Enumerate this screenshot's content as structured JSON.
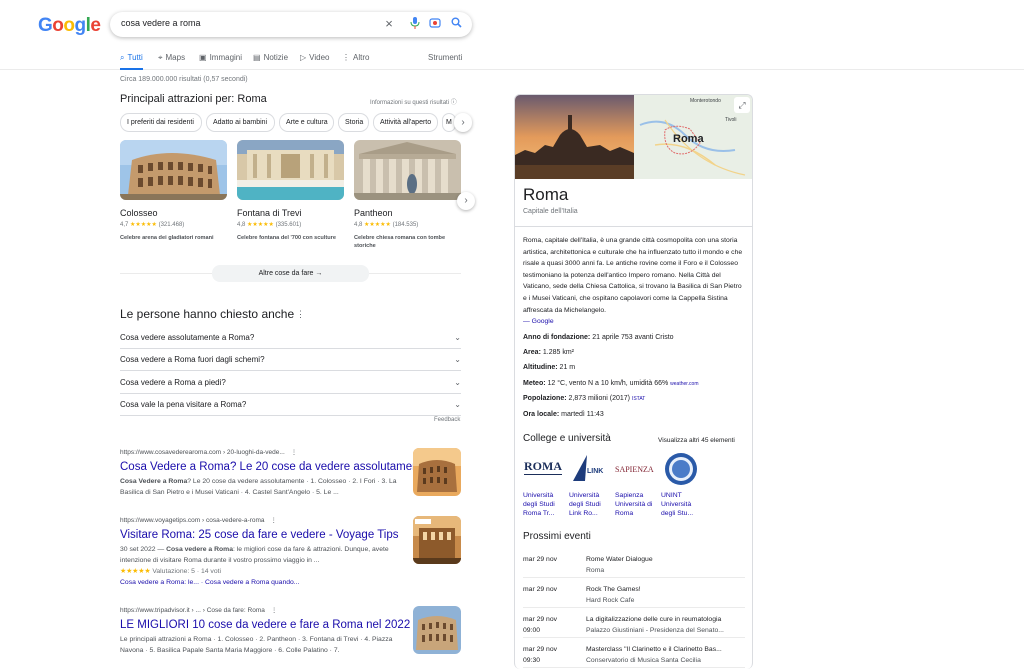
{
  "logo": {
    "letters": [
      "G",
      "o",
      "o",
      "g",
      "l",
      "e"
    ],
    "colors": [
      "#4285f4",
      "#ea4335",
      "#fbbc05",
      "#4285f4",
      "#34a853",
      "#ea4335"
    ]
  },
  "search": {
    "query": "cosa vedere a roma"
  },
  "tabs": [
    {
      "label": "Tutti",
      "icon": "search-icon"
    },
    {
      "label": "Maps",
      "icon": "map-pin-icon"
    },
    {
      "label": "Immagini",
      "icon": "image-icon"
    },
    {
      "label": "Notizie",
      "icon": "news-icon"
    },
    {
      "label": "Video",
      "icon": "video-icon"
    },
    {
      "label": "Altro",
      "icon": "more-icon"
    },
    {
      "label": "Strumenti"
    }
  ],
  "stats": "Circa 189.000.000 risultati (0,57 secondi)",
  "attractions": {
    "title": "Principali attrazioni per: Roma",
    "info": "Informazioni su questi risultati",
    "chips": [
      "I preferiti dai residenti",
      "Adatto ai bambini",
      "Arte e cultura",
      "Storia",
      "Attività all'aperto",
      "M"
    ],
    "cards": [
      {
        "name": "Colosseo",
        "rating": "4,7",
        "reviews": "(321.468)",
        "desc": "Celebre arena dei gladiatori romani"
      },
      {
        "name": "Fontana di Trevi",
        "rating": "4,8",
        "reviews": "(335.601)",
        "desc": "Celebre fontana del '700 con sculture"
      },
      {
        "name": "Pantheon",
        "rating": "4,8",
        "reviews": "(184.535)",
        "desc": "Celebre chiesa romana con tombe storiche"
      }
    ],
    "more": "Altre cose da fare"
  },
  "paa": {
    "title": "Le persone hanno chiesto anche",
    "questions": [
      "Cosa vedere assolutamente a Roma?",
      "Cosa vedere a Roma fuori dagli schemi?",
      "Cosa vedere a Roma a piedi?",
      "Cosa vale la pena visitare a Roma?"
    ],
    "feedback": "Feedback"
  },
  "results": [
    {
      "url": "https://www.cosavederearoma.com › 20-luoghi-da-vede...",
      "title": "Cosa Vedere a Roma? Le 20 cose da vedere assolutamente",
      "snippet_bold": "Cosa Vedere a Roma",
      "snippet": "? Le 20 cose da vedere assolutamente · 1. Colosseo · 2. I Fori · 3. La Basilica di San Pietro e i Musei Vaticani · 4. Castel Sant'Angelo · 5. Le ..."
    },
    {
      "url": "https://www.voyagetips.com › cosa-vedere-a-roma",
      "title": "Visitare Roma: 25 cose da fare e vedere - Voyage Tips",
      "date": "30 set 2022 — ",
      "snippet_bold": "Cosa vedere a Roma",
      "snippet": ": le migliori cose da fare & attrazioni. Dunque, avete intenzione di visitare Roma durante il vostro prossimo viaggio in ...",
      "rating": "Valutazione: 5 · 14 voti",
      "links": "Cosa vedere a Roma: le... · Cosa vedere a Roma quando..."
    },
    {
      "url": "https://www.tripadvisor.it › ... › Cose da fare: Roma",
      "title": "LE MIGLIORI 10 cose da vedere e fare a Roma nel 2022",
      "snippet": "Le principali attrazioni a Roma · 1. Colosseo · 2. Pantheon · 3. Fontana di Trevi · 4. Piazza Navona · 5. Basilica Papale Santa Maria Maggiore · 6. Colle Palatino · 7."
    }
  ],
  "knowledge": {
    "title": "Roma",
    "subtitle": "Capitale dell'Italia",
    "map_label": "Roma",
    "map_places": [
      "Monterotondo",
      "Tivoli"
    ],
    "description": "Roma, capitale dell'Italia, è una grande città cosmopolita con una storia artistica, architettonica e culturale che ha influenzato tutto il mondo e che risale a quasi 3000 anni fa. Le antiche rovine come il Foro e il Colosseo testimoniano la potenza dell'antico Impero romano. Nella Città del Vaticano, sede della Chiesa Cattolica, si trovano la Basilica di San Pietro e i Musei Vaticani, che ospitano capolavori come la Cappella Sistina affrescata da Michelangelo.",
    "source": "— Google",
    "facts": [
      {
        "k": "Anno di fondazione:",
        "v": " 21 aprile 753 avanti Cristo"
      },
      {
        "k": "Area:",
        "v": " 1.285 km²"
      },
      {
        "k": "Altitudine:",
        "v": " 21 m"
      },
      {
        "k": "Meteo:",
        "v": " 12 °C, vento N a 10 km/h, umidità 66% ",
        "extra": "weather.com"
      },
      {
        "k": "Popolazione:",
        "v": " 2,873 milioni (2017) ",
        "extra": "ISTAT"
      },
      {
        "k": "Ora locale:",
        "v": " martedì 11:43"
      }
    ],
    "colleges": {
      "title": "College e università",
      "more": "Visualizza altri 45 elementi",
      "items": [
        {
          "name": "Università degli Studi Roma Tr...",
          "logo": "ROMA TRE"
        },
        {
          "name": "Università degli Studi Link Ro...",
          "logo": "LINK"
        },
        {
          "name": "Sapienza Università di Roma",
          "logo": "SAPIENZA"
        },
        {
          "name": "UNINT Università degli Stu...",
          "logo": "UNINT"
        }
      ]
    },
    "events": {
      "title": "Prossimi eventi",
      "items": [
        {
          "date": "mar 29 nov",
          "time": "",
          "name": "Rome Water Dialogue",
          "place": "Roma"
        },
        {
          "date": "mar 29 nov",
          "time": "",
          "name": "Rock The Games!",
          "place": "Hard Rock Cafe"
        },
        {
          "date": "mar 29 nov",
          "time": "09:00",
          "name": "La digitalizzazione delle cure in reumatologia",
          "place": "Palazzo Giustiniani - Presidenza del Senato..."
        },
        {
          "date": "mar 29 nov",
          "time": "09:30",
          "name": "Masterclass \"Il Clarinetto e il Clarinetto Bas...",
          "place": "Conservatorio di Musica Santa Cecilia"
        }
      ]
    }
  }
}
